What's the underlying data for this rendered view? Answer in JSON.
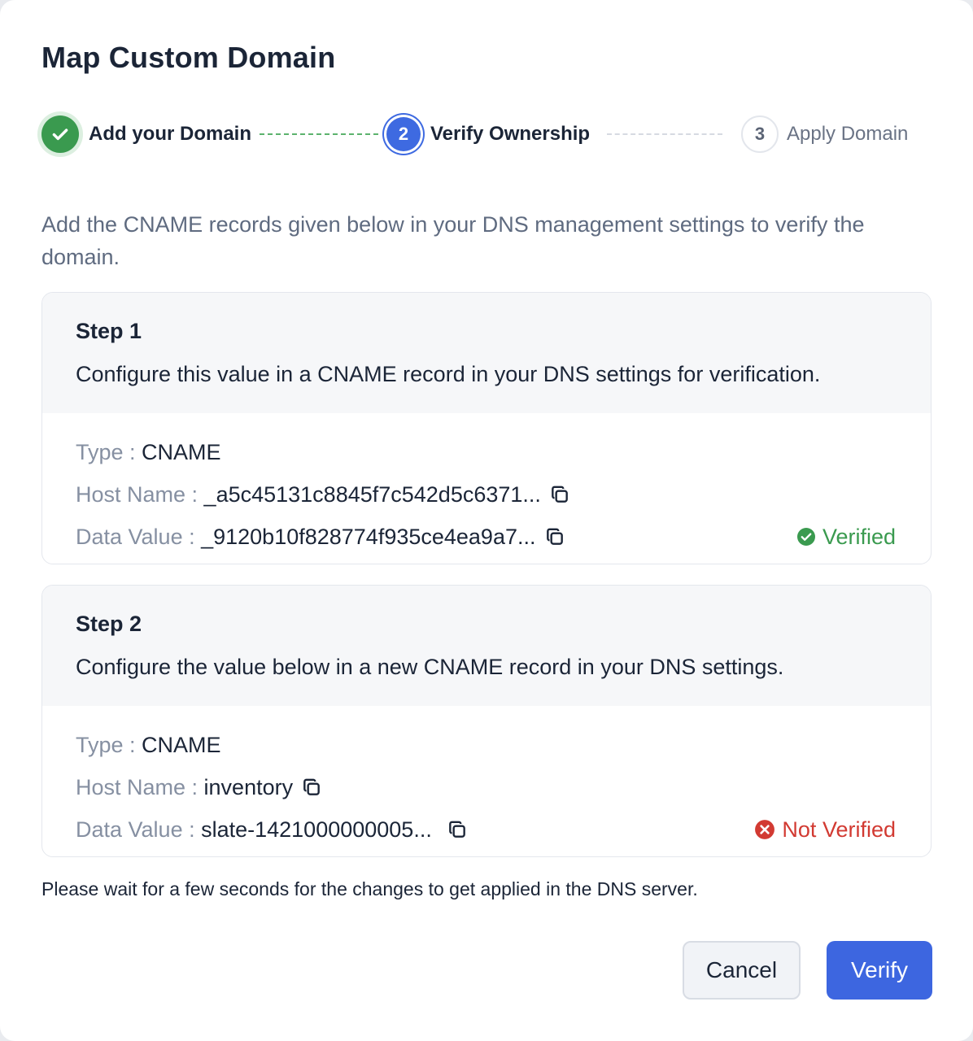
{
  "dialog": {
    "title": "Map Custom Domain",
    "intro": "Add the CNAME records given below in your DNS management settings to verify the domain.",
    "note": "Please wait for a few seconds for the changes to get applied in the DNS server.",
    "cancel_label": "Cancel",
    "verify_label": "Verify"
  },
  "stepper": {
    "steps": [
      {
        "number": "1",
        "label": "Add your Domain",
        "state": "completed",
        "icon": "check-icon"
      },
      {
        "number": "2",
        "label": "Verify Ownership",
        "state": "active"
      },
      {
        "number": "3",
        "label": "Apply Domain",
        "state": "pending"
      }
    ]
  },
  "records": [
    {
      "step": "Step 1",
      "description": "Configure this value in a CNAME record in your DNS settings for verification.",
      "type_label": "Type : ",
      "type_value": "CNAME",
      "host_label": "Host Name : ",
      "host_value": "_a5c45131c8845f7c542d5c6371...",
      "data_label": "Data Value : ",
      "data_value": "_9120b10f828774f935ce4ea9a7...",
      "status": "Verified",
      "status_icon": "check-circle-icon",
      "status_color": "#3a9a4f"
    },
    {
      "step": "Step 2",
      "description": "Configure the value below in a new CNAME record in your DNS settings.",
      "type_label": "Type : ",
      "type_value": "CNAME",
      "host_label": "Host Name : ",
      "host_value": "inventory",
      "data_label": "Data Value : ",
      "data_value": "slate-1421000000005...",
      "status": "Not Verified",
      "status_icon": "x-circle-icon",
      "status_color": "#d23a32"
    }
  ],
  "colors": {
    "primary": "#3d66e0",
    "success": "#3a9a4f",
    "danger": "#d23a32"
  }
}
